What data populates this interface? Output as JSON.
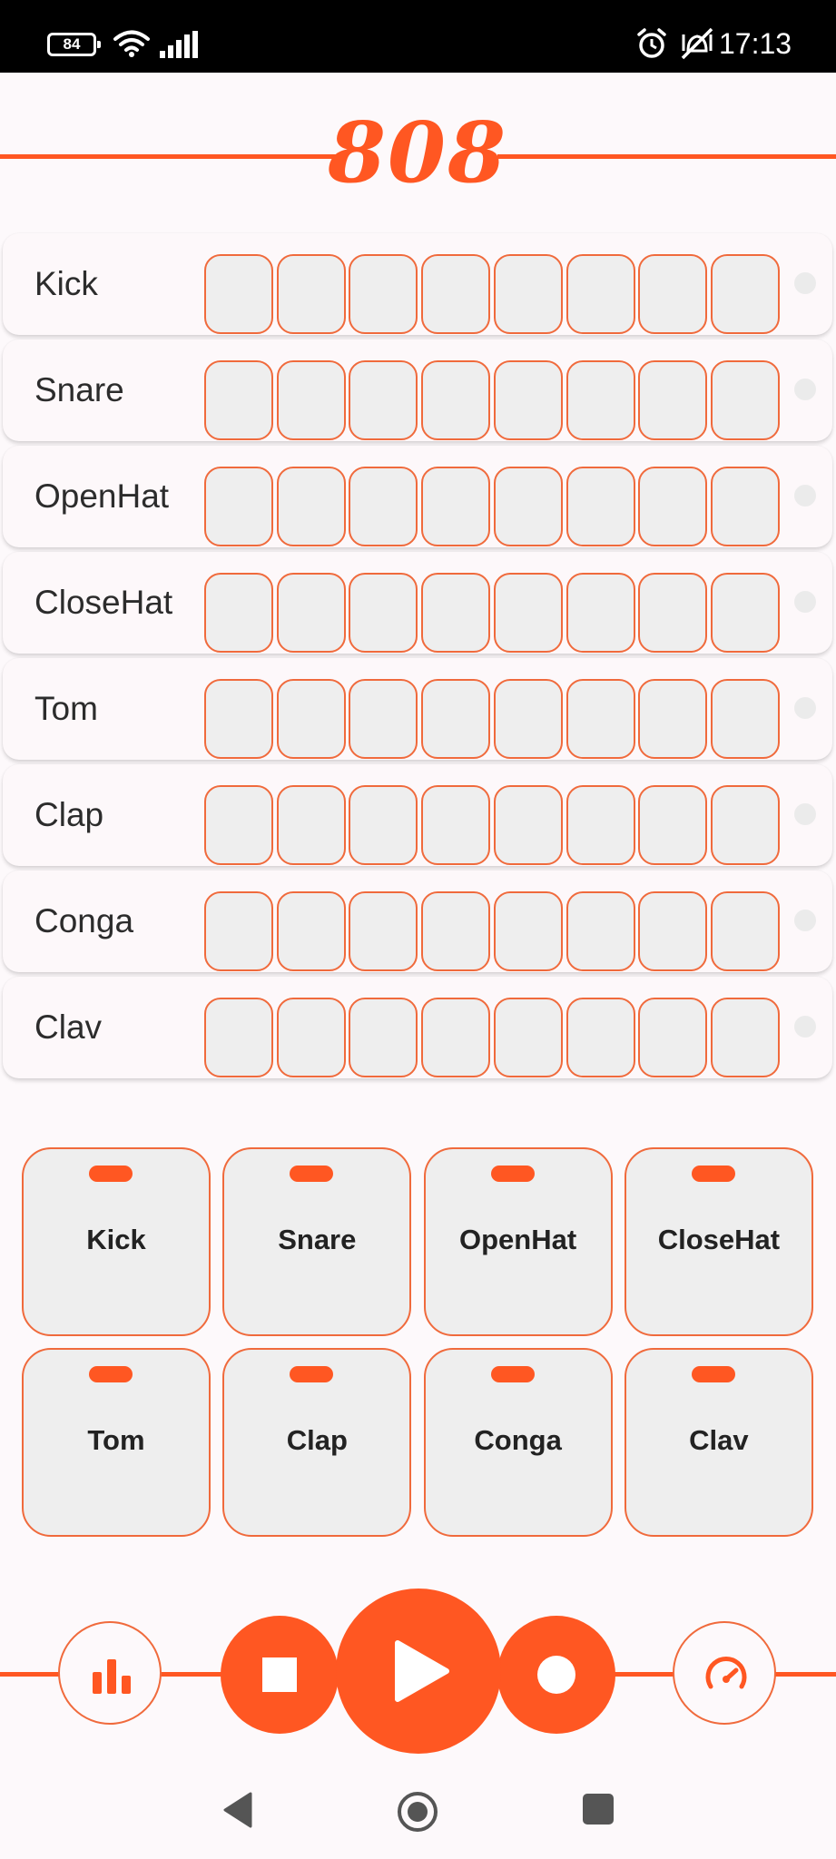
{
  "status_bar": {
    "battery": "84",
    "time": "17:13"
  },
  "app": {
    "title": "808",
    "accent": "#ff5722"
  },
  "tracks": [
    {
      "label": "Kick"
    },
    {
      "label": "Snare"
    },
    {
      "label": "OpenHat"
    },
    {
      "label": "CloseHat"
    },
    {
      "label": "Tom"
    },
    {
      "label": "Clap"
    },
    {
      "label": "Conga"
    },
    {
      "label": "Clav"
    }
  ],
  "steps_per_track": 8,
  "pads": [
    {
      "label": "Kick"
    },
    {
      "label": "Snare"
    },
    {
      "label": "OpenHat"
    },
    {
      "label": "CloseHat"
    },
    {
      "label": "Tom"
    },
    {
      "label": "Clap"
    },
    {
      "label": "Conga"
    },
    {
      "label": "Clav"
    }
  ],
  "transport": {
    "left_icon": "bar-chart-icon",
    "stop_icon": "stop-icon",
    "play_icon": "play-icon",
    "record_icon": "record-icon",
    "right_icon": "speedometer-icon"
  }
}
